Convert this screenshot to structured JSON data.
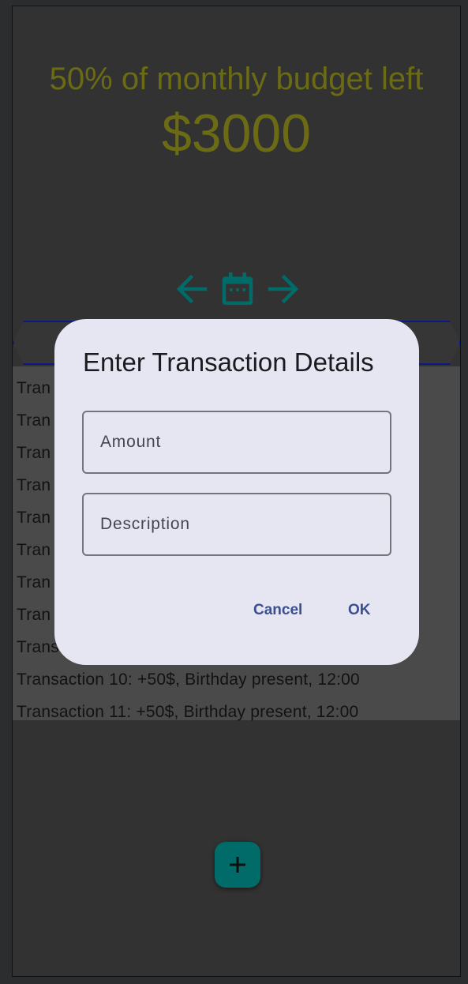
{
  "budget": {
    "label": "50% of monthly budget left",
    "amount": "$3000",
    "color": "#6b6b16"
  },
  "nav": {
    "prev_icon": "arrow-left-icon",
    "calendar_icon": "calendar-icon",
    "next_icon": "arrow-right-icon",
    "accent": "#006b69"
  },
  "transactions": [
    {
      "text": "Tran"
    },
    {
      "text": "Tran"
    },
    {
      "text": "Tran"
    },
    {
      "text": "Tran"
    },
    {
      "text": "Tran"
    },
    {
      "text": "Tran"
    },
    {
      "text": "Tran"
    },
    {
      "text": "Tran"
    },
    {
      "text": "Trans"
    },
    {
      "text": "Transaction 10: +50$, Birthday present, 12:00"
    },
    {
      "text": "Transaction 11: +50$, Birthday present, 12:00"
    }
  ],
  "fab": {
    "icon": "plus-icon"
  },
  "dialog": {
    "title": "Enter Transaction Details",
    "amount_placeholder": "Amount",
    "description_placeholder": "Description",
    "cancel_label": "Cancel",
    "ok_label": "OK"
  }
}
